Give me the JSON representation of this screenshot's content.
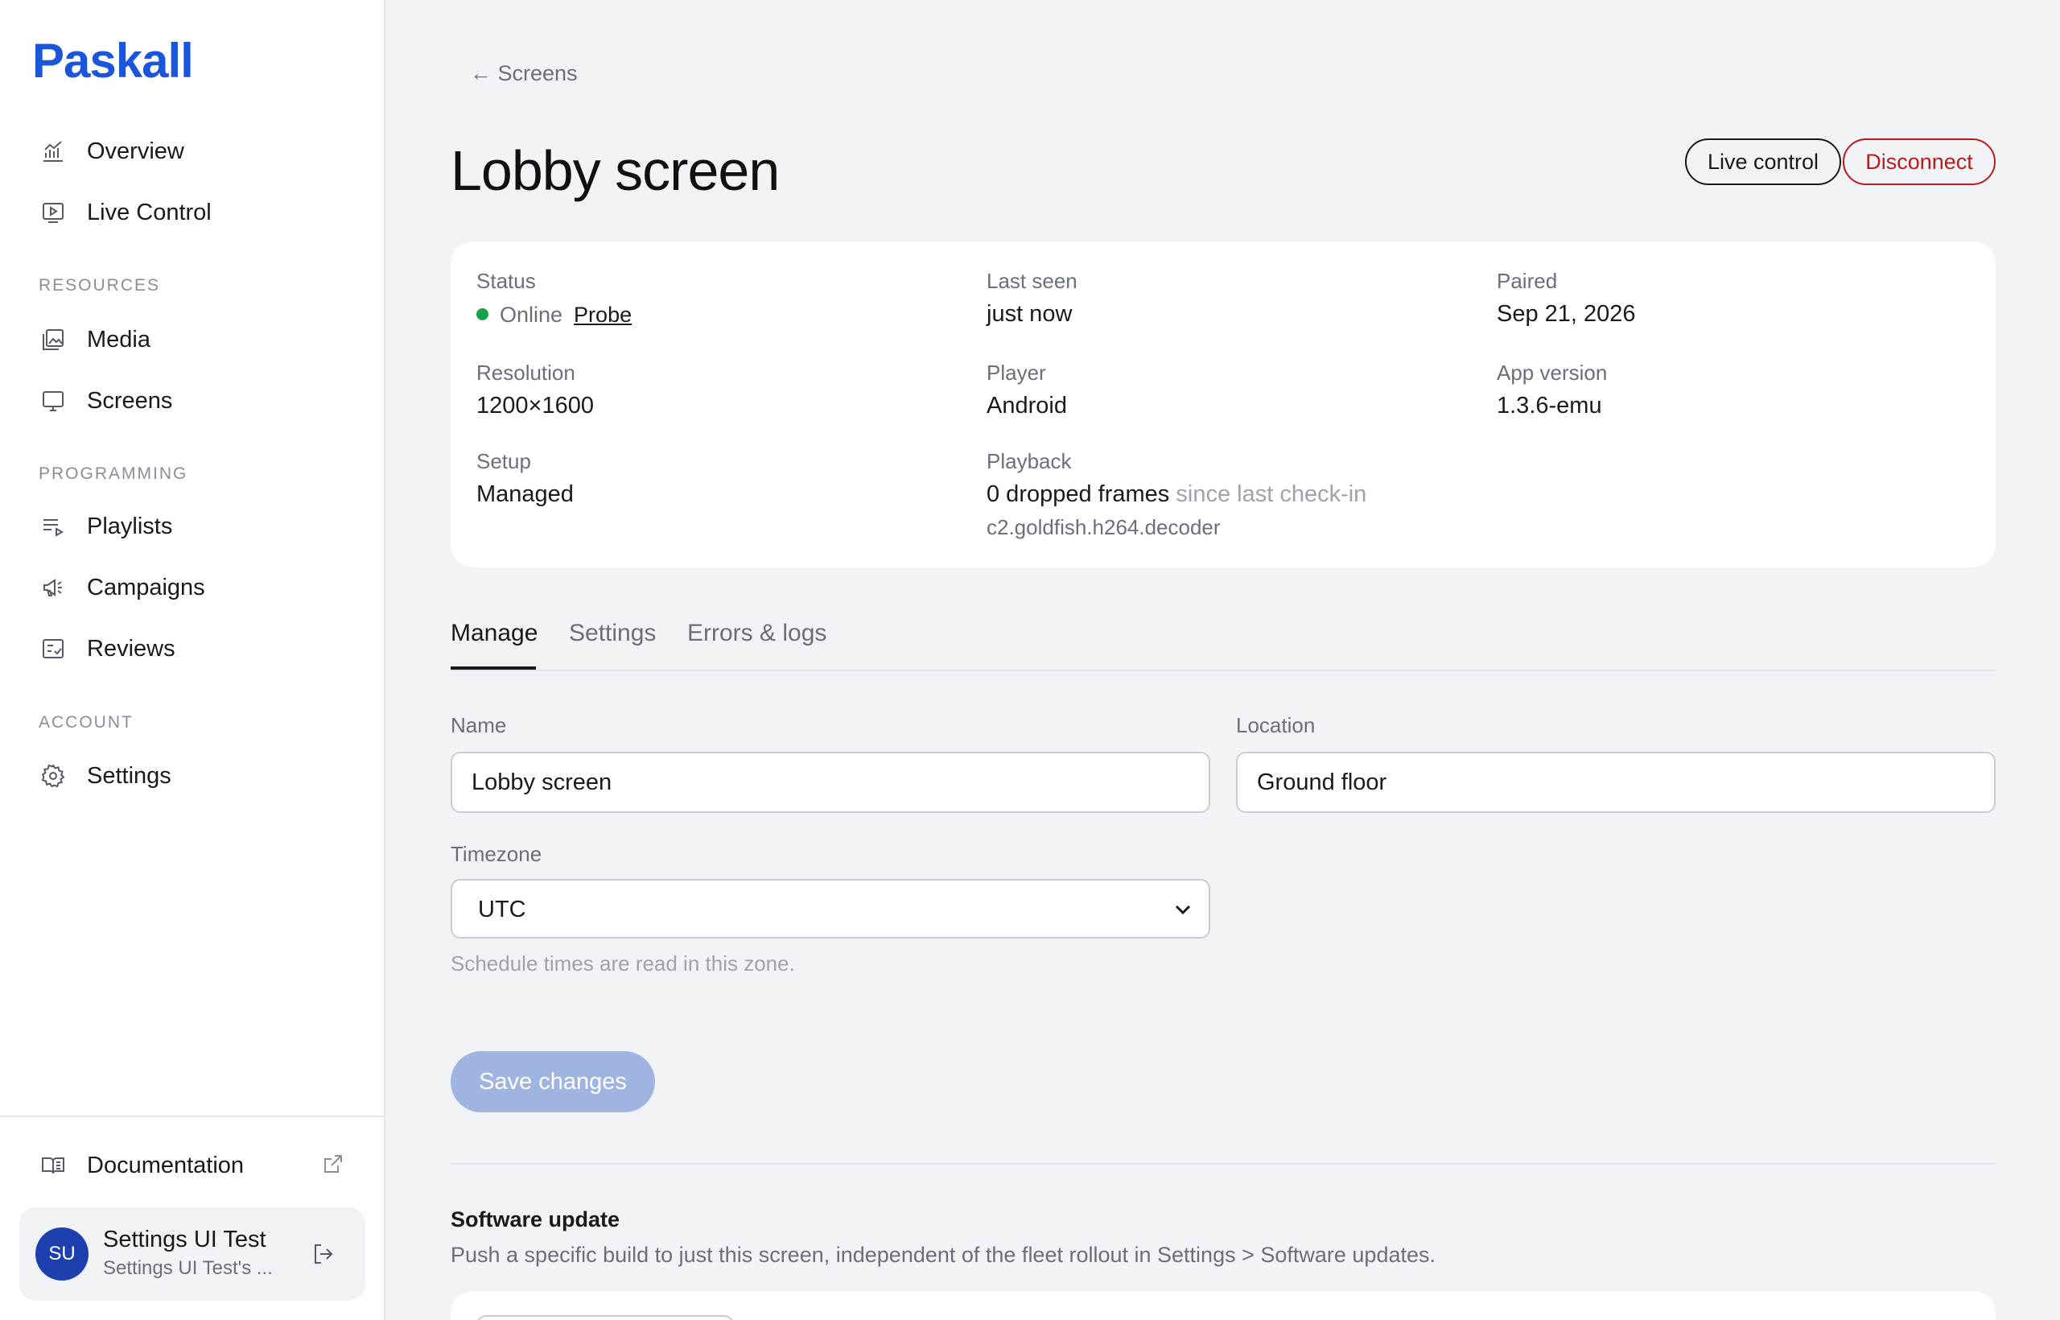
{
  "brand": {
    "name": "Paskall",
    "color": "#1a56db"
  },
  "sidebar": {
    "items": [
      {
        "label": "Overview",
        "icon": "chart-icon"
      },
      {
        "label": "Live Control",
        "icon": "play-screen-icon"
      }
    ],
    "sections": {
      "resources": "RESOURCES",
      "programming": "PROGRAMMING",
      "account": "ACCOUNT"
    },
    "resources_items": [
      {
        "label": "Media",
        "icon": "images-icon"
      },
      {
        "label": "Screens",
        "icon": "monitor-icon"
      }
    ],
    "programming_items": [
      {
        "label": "Playlists",
        "icon": "playlist-icon"
      },
      {
        "label": "Campaigns",
        "icon": "megaphone-icon"
      },
      {
        "label": "Reviews",
        "icon": "checklist-icon"
      }
    ],
    "account_items": [
      {
        "label": "Settings",
        "icon": "gear-icon"
      }
    ],
    "documentation": "Documentation",
    "user": {
      "initials": "SU",
      "name": "Settings UI Test",
      "org": "Settings UI Test's ..."
    }
  },
  "header": {
    "back_label": "← Screens",
    "title": "Lobby screen",
    "live_control": "Live control",
    "disconnect": "Disconnect"
  },
  "info": {
    "status_label": "Status",
    "status_value": "Online",
    "probe": "Probe",
    "last_seen_label": "Last seen",
    "last_seen_value": "just now",
    "paired_label": "Paired",
    "paired_value": "Sep 21, 2026",
    "resolution_label": "Resolution",
    "resolution_value": "1200×1600",
    "player_label": "Player",
    "player_value": "Android",
    "app_version_label": "App version",
    "app_version_value": "1.3.6-emu",
    "setup_label": "Setup",
    "setup_value": "Managed",
    "playback_label": "Playback",
    "playback_value": "0 dropped frames",
    "playback_suffix": "since last check-in",
    "decoder": "c2.goldfish.h264.decoder"
  },
  "tabs": [
    {
      "label": "Manage",
      "active": true
    },
    {
      "label": "Settings",
      "active": false
    },
    {
      "label": "Errors & logs",
      "active": false
    }
  ],
  "form": {
    "name_label": "Name",
    "name_value": "Lobby screen",
    "location_label": "Location",
    "location_value": "Ground floor",
    "timezone_label": "Timezone",
    "timezone_value": "UTC",
    "timezone_hint": "Schedule times are read in this zone.",
    "save": "Save changes"
  },
  "software_update": {
    "title": "Software update",
    "description": "Push a specific build to just this screen, independent of the fleet rollout in Settings > Software updates."
  }
}
